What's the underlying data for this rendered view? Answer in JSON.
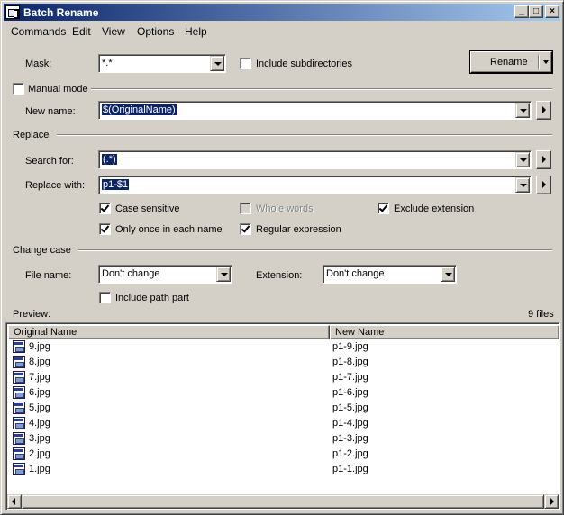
{
  "window": {
    "title": "Batch Rename",
    "controls": {
      "minimize": "_",
      "maximize": "□",
      "close": "×"
    }
  },
  "menu": [
    "Commands",
    "Edit",
    "View",
    "Options",
    "Help"
  ],
  "mask": {
    "label": "Mask:",
    "value": "*.*"
  },
  "include_subdirectories": {
    "label": "Include subdirectories",
    "checked": false
  },
  "rename_button": {
    "label": "Rename"
  },
  "manual_mode": {
    "label": "Manual mode",
    "checked": false
  },
  "new_name": {
    "label": "New name:",
    "value": "$(OriginalName)"
  },
  "replace": {
    "group_label": "Replace",
    "search_label": "Search for:",
    "search_value": "(.*)",
    "replace_label": "Replace with:",
    "replace_value": "p1-$1"
  },
  "options": {
    "case_sensitive": {
      "label": "Case sensitive",
      "checked": true
    },
    "whole_words": {
      "label": "Whole words",
      "checked": false,
      "disabled": true
    },
    "exclude_extension": {
      "label": "Exclude extension",
      "checked": true
    },
    "only_once": {
      "label": "Only once in each name",
      "checked": true
    },
    "regular_expression": {
      "label": "Regular expression",
      "checked": true
    }
  },
  "change_case": {
    "group_label": "Change case",
    "file_name_label": "File name:",
    "file_name_value": "Don't change",
    "extension_label": "Extension:",
    "extension_value": "Don't change",
    "include_path_part": {
      "label": "Include path part",
      "checked": false
    }
  },
  "preview": {
    "label": "Preview:",
    "count": "9 files",
    "columns": [
      "Original Name",
      "New Name"
    ],
    "rows": [
      {
        "original": "9.jpg",
        "new": "p1-9.jpg"
      },
      {
        "original": "8.jpg",
        "new": "p1-8.jpg"
      },
      {
        "original": "7.jpg",
        "new": "p1-7.jpg"
      },
      {
        "original": "6.jpg",
        "new": "p1-6.jpg"
      },
      {
        "original": "5.jpg",
        "new": "p1-5.jpg"
      },
      {
        "original": "4.jpg",
        "new": "p1-4.jpg"
      },
      {
        "original": "3.jpg",
        "new": "p1-3.jpg"
      },
      {
        "original": "2.jpg",
        "new": "p1-2.jpg"
      },
      {
        "original": "1.jpg",
        "new": "p1-1.jpg"
      }
    ]
  },
  "icons": {
    "app": "batch-rename-app-icon",
    "file": "image-file-icon"
  }
}
